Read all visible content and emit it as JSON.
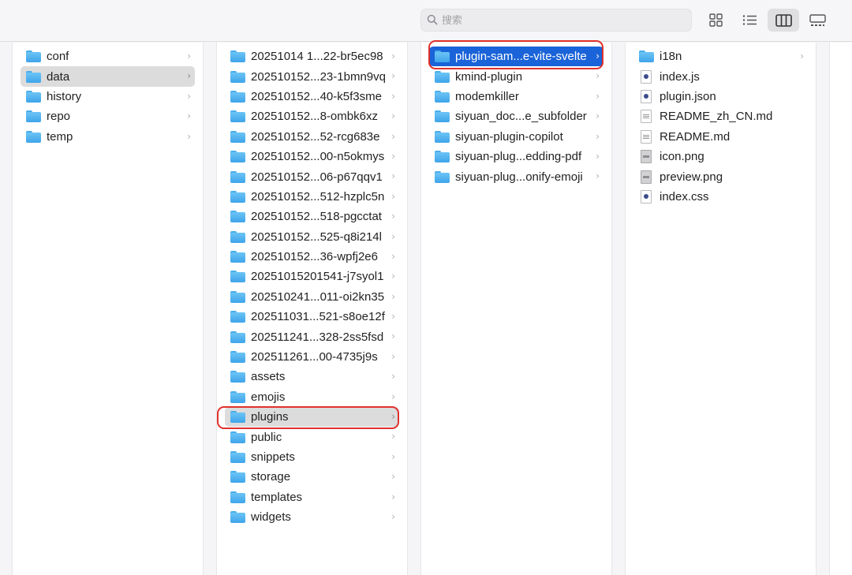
{
  "search": {
    "placeholder": "搜索"
  },
  "toolbar": {
    "view_modes": [
      "icon-view-icon",
      "list-view-icon",
      "column-view-icon",
      "gallery-view-icon"
    ],
    "active_view": "column-view-icon"
  },
  "column1": {
    "items": [
      {
        "label": "conf",
        "type": "folder"
      },
      {
        "label": "data",
        "type": "folder",
        "selected": "gray"
      },
      {
        "label": "history",
        "type": "folder"
      },
      {
        "label": "repo",
        "type": "folder"
      },
      {
        "label": "temp",
        "type": "folder"
      }
    ]
  },
  "column2": {
    "items": [
      {
        "label": "20251014 1...22-br5ec98",
        "type": "folder"
      },
      {
        "label": "202510152...23-1bmn9vq",
        "type": "folder"
      },
      {
        "label": "202510152...40-k5f3sme",
        "type": "folder"
      },
      {
        "label": "202510152...8-ombk6xz",
        "type": "folder"
      },
      {
        "label": "202510152...52-rcg683e",
        "type": "folder"
      },
      {
        "label": "202510152...00-n5okmys",
        "type": "folder"
      },
      {
        "label": "202510152...06-p67qqv1",
        "type": "folder"
      },
      {
        "label": "202510152...512-hzplc5n",
        "type": "folder"
      },
      {
        "label": "202510152...518-pgcctat",
        "type": "folder"
      },
      {
        "label": "202510152...525-q8i214l",
        "type": "folder"
      },
      {
        "label": "202510152...36-wpfj2e6",
        "type": "folder"
      },
      {
        "label": "20251015201541-j7syol1",
        "type": "folder"
      },
      {
        "label": "202510241...011-oi2kn35",
        "type": "folder"
      },
      {
        "label": "202511031...521-s8oe12f",
        "type": "folder"
      },
      {
        "label": "202511241...328-2ss5fsd",
        "type": "folder"
      },
      {
        "label": "202511261...00-4735j9s",
        "type": "folder"
      },
      {
        "label": "assets",
        "type": "folder"
      },
      {
        "label": "emojis",
        "type": "folder"
      },
      {
        "label": "plugins",
        "type": "folder",
        "selected": "gray"
      },
      {
        "label": "public",
        "type": "folder"
      },
      {
        "label": "snippets",
        "type": "folder"
      },
      {
        "label": "storage",
        "type": "folder"
      },
      {
        "label": "templates",
        "type": "folder"
      },
      {
        "label": "widgets",
        "type": "folder"
      }
    ]
  },
  "column3": {
    "items": [
      {
        "label": "plugin-sam...e-vite-svelte",
        "type": "folder",
        "selected": "blue"
      },
      {
        "label": "kmind-plugin",
        "type": "folder"
      },
      {
        "label": "modemkiller",
        "type": "folder"
      },
      {
        "label": "siyuan_doc...e_subfolder",
        "type": "folder"
      },
      {
        "label": "siyuan-plugin-copilot",
        "type": "folder"
      },
      {
        "label": "siyuan-plug...edding-pdf",
        "type": "folder"
      },
      {
        "label": "siyuan-plug...onify-emoji",
        "type": "folder"
      }
    ]
  },
  "column4": {
    "items": [
      {
        "label": "i18n",
        "type": "folder"
      },
      {
        "label": "index.js",
        "type": "file",
        "icon": "js-file-icon"
      },
      {
        "label": "plugin.json",
        "type": "file",
        "icon": "json-file-icon"
      },
      {
        "label": "README_zh_CN.md",
        "type": "file",
        "icon": "md-file-icon"
      },
      {
        "label": "README.md",
        "type": "file",
        "icon": "md-file-icon"
      },
      {
        "label": "icon.png",
        "type": "file",
        "icon": "image-file-icon"
      },
      {
        "label": "preview.png",
        "type": "file",
        "icon": "image-file-icon"
      },
      {
        "label": "index.css",
        "type": "file",
        "icon": "css-file-icon"
      }
    ]
  },
  "colors": {
    "selection_blue": "#1a63d8",
    "selection_gray": "#dcdcdc",
    "highlight_red": "#e0312d",
    "folder_blue": "#4aaeea"
  }
}
